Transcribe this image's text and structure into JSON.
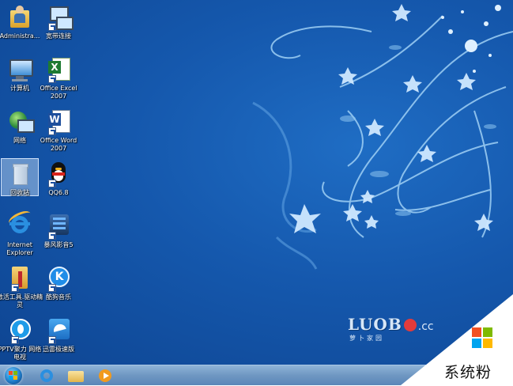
{
  "desktop": {
    "icons": [
      {
        "label": "Administra..."
      },
      {
        "label": "宽带连接"
      },
      {
        "label": "计算机"
      },
      {
        "label": "Office Excel 2007"
      },
      {
        "label": "网络"
      },
      {
        "label": "Office Word 2007"
      },
      {
        "label": "回收站"
      },
      {
        "label": "QQ6.8"
      },
      {
        "label": "Internet Explorer"
      },
      {
        "label": "暴风影音5"
      },
      {
        "label": "激活工具.驱动精灵"
      },
      {
        "label": "酷狗音乐"
      },
      {
        "label": "PPTV聚力 网络电视"
      },
      {
        "label": "迅雷极速版"
      }
    ]
  },
  "wallpaper": {
    "logo_text": "LUOB",
    "logo_suffix": ".cc",
    "logo_sub": "萝卜家园"
  },
  "taskbar": {
    "pinned": [
      "start-button",
      "ie-icon",
      "explorer-icon",
      "media-player-icon"
    ]
  },
  "watermark": {
    "text": "系统粉",
    "colors": {
      "red": "#f25022",
      "green": "#7fba00",
      "blue": "#00a4ef",
      "yellow": "#ffb900"
    }
  }
}
